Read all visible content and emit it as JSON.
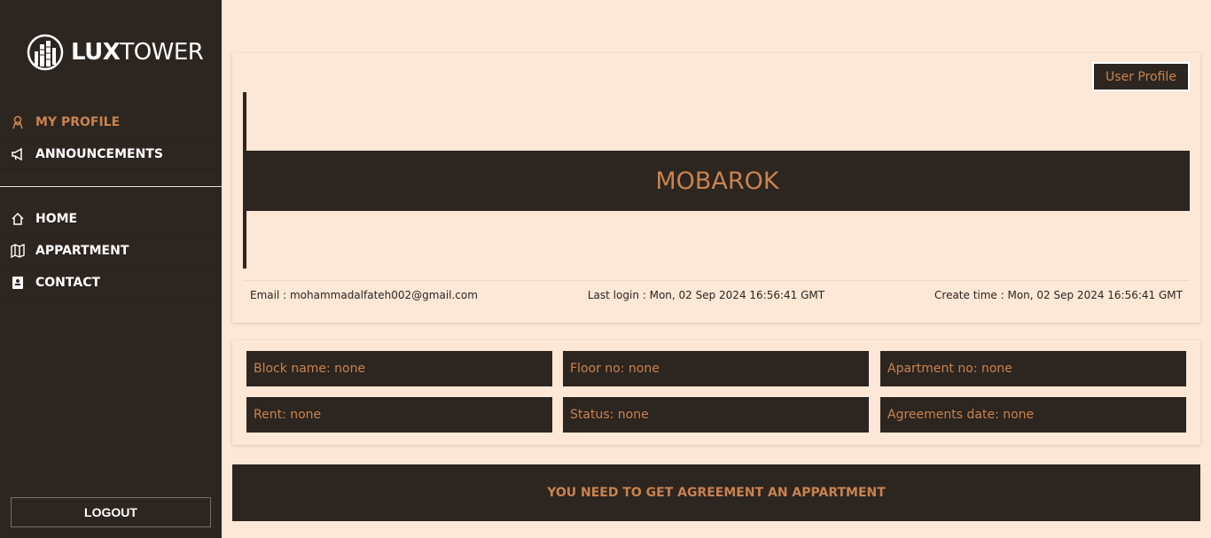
{
  "brand": {
    "bold": "LUX",
    "light": "TOWER"
  },
  "sidebar": {
    "primary": [
      {
        "label": "MY PROFILE",
        "icon": "user-badge-icon",
        "active": true
      },
      {
        "label": "ANNOUNCEMENTS",
        "icon": "megaphone-icon",
        "active": false
      }
    ],
    "secondary": [
      {
        "label": "HOME",
        "icon": "home-icon"
      },
      {
        "label": "APPARTMENT",
        "icon": "map-icon"
      },
      {
        "label": "CONTACT",
        "icon": "contact-card-icon"
      }
    ],
    "logout_label": "LOGOUT"
  },
  "profile": {
    "user_profile_button": "User Profile",
    "name": "MOBAROK",
    "email": "Email : mohammadalfateh002@gmail.com",
    "last_login": "Last login : Mon, 02 Sep 2024 16:56:41 GMT",
    "create_time": "Create time : Mon, 02 Sep 2024 16:56:41 GMT"
  },
  "details": {
    "block": "Block name: none",
    "floor": "Floor no: none",
    "apartment": "Apartment no: none",
    "rent": "Rent: none",
    "status": "Status: none",
    "agreement_date": "Agreements date: none"
  },
  "notice": "YOU NEED TO GET AGREEMENT AN APPARTMENT",
  "colors": {
    "sidebar_bg": "#2d2520",
    "page_bg": "#fde7d6",
    "accent": "#c8834f",
    "text_light": "#ffffff"
  }
}
